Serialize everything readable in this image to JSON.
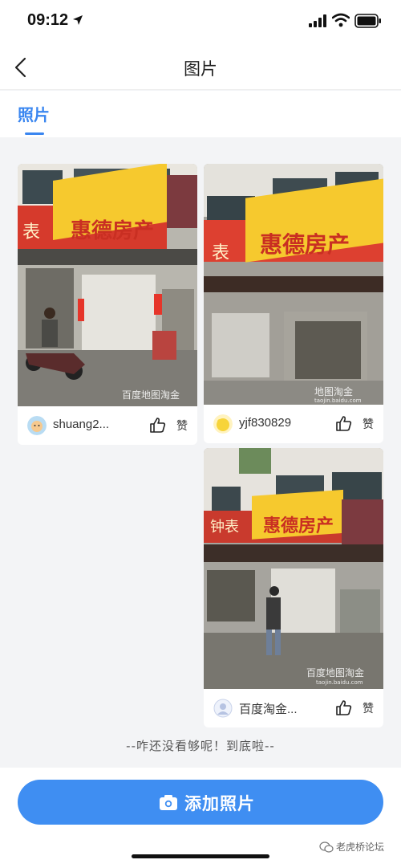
{
  "status_bar": {
    "time": "09:12"
  },
  "nav": {
    "title": "图片"
  },
  "tabs": [
    {
      "label": "照片"
    }
  ],
  "photos": [
    {
      "user": "shuang2...",
      "like_label": "赞",
      "sign_big": "惠德房产",
      "sign_left": "表",
      "watermark": "百度地图淘金"
    },
    {
      "user": "yjf830829",
      "like_label": "赞",
      "sign_big": "惠德房产",
      "sign_left": "表",
      "watermark": "地图淘金",
      "watermark_url": "taojin.baidu.com"
    },
    {
      "user": "百度淘金...",
      "like_label": "赞",
      "sign_big": "惠德房产",
      "sign_left": "钟表",
      "watermark": "百度地图淘金",
      "watermark_url": "taojin.baidu.com"
    }
  ],
  "footer": {
    "end_text": "--咋还没看够呢！到底啦--"
  },
  "bottom": {
    "add_label": "添加照片",
    "watermark": "老虎桥论坛"
  },
  "colors": {
    "accent": "#3f8ef2",
    "sign_yellow": "#f6c92e",
    "sign_red": "#c92f22"
  }
}
